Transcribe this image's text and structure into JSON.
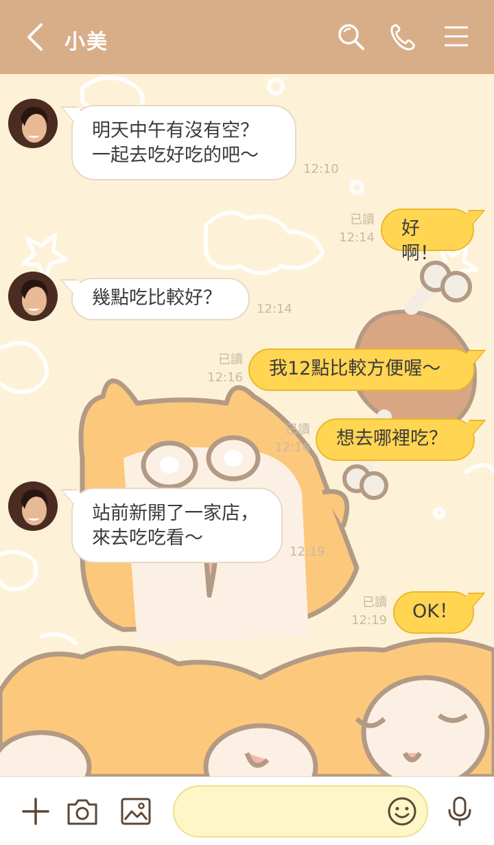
{
  "header": {
    "contact_name": "小美",
    "back_icon": "chevron-left-icon",
    "search_icon": "search-icon",
    "call_icon": "phone-icon",
    "menu_icon": "menu-icon",
    "background_color": "#d8ae88"
  },
  "messages": [
    {
      "direction": "in",
      "text": "明天中午有沒有空？\n一起去吃好吃的吧～",
      "time": "12:10"
    },
    {
      "direction": "out",
      "text": "好啊！",
      "status": "已讀",
      "time": "12:14"
    },
    {
      "direction": "in",
      "text": "幾點吃比較好？",
      "time": "12:14"
    },
    {
      "direction": "out",
      "text": "我12點比較方便喔～",
      "status": "已讀",
      "time": "12:16"
    },
    {
      "direction": "out",
      "text": "想去哪裡吃？",
      "status": "已讀",
      "time": "12:16"
    },
    {
      "direction": "in",
      "text": "站前新開了一家店，\n來去吃吃看～",
      "time": "12:19"
    },
    {
      "direction": "out",
      "text": "OK！",
      "status": "已讀",
      "time": "12:19"
    }
  ],
  "input_bar": {
    "add_icon": "plus-icon",
    "camera_icon": "camera-icon",
    "image_icon": "image-icon",
    "message_placeholder": "",
    "emoji_icon": "smiley-icon",
    "mic_icon": "microphone-icon",
    "field_color": "#fdf6c6"
  },
  "colors": {
    "chat_background": "#fdf1d8",
    "outgoing_bubble": "#ffd552",
    "incoming_bubble": "#ffffff"
  }
}
